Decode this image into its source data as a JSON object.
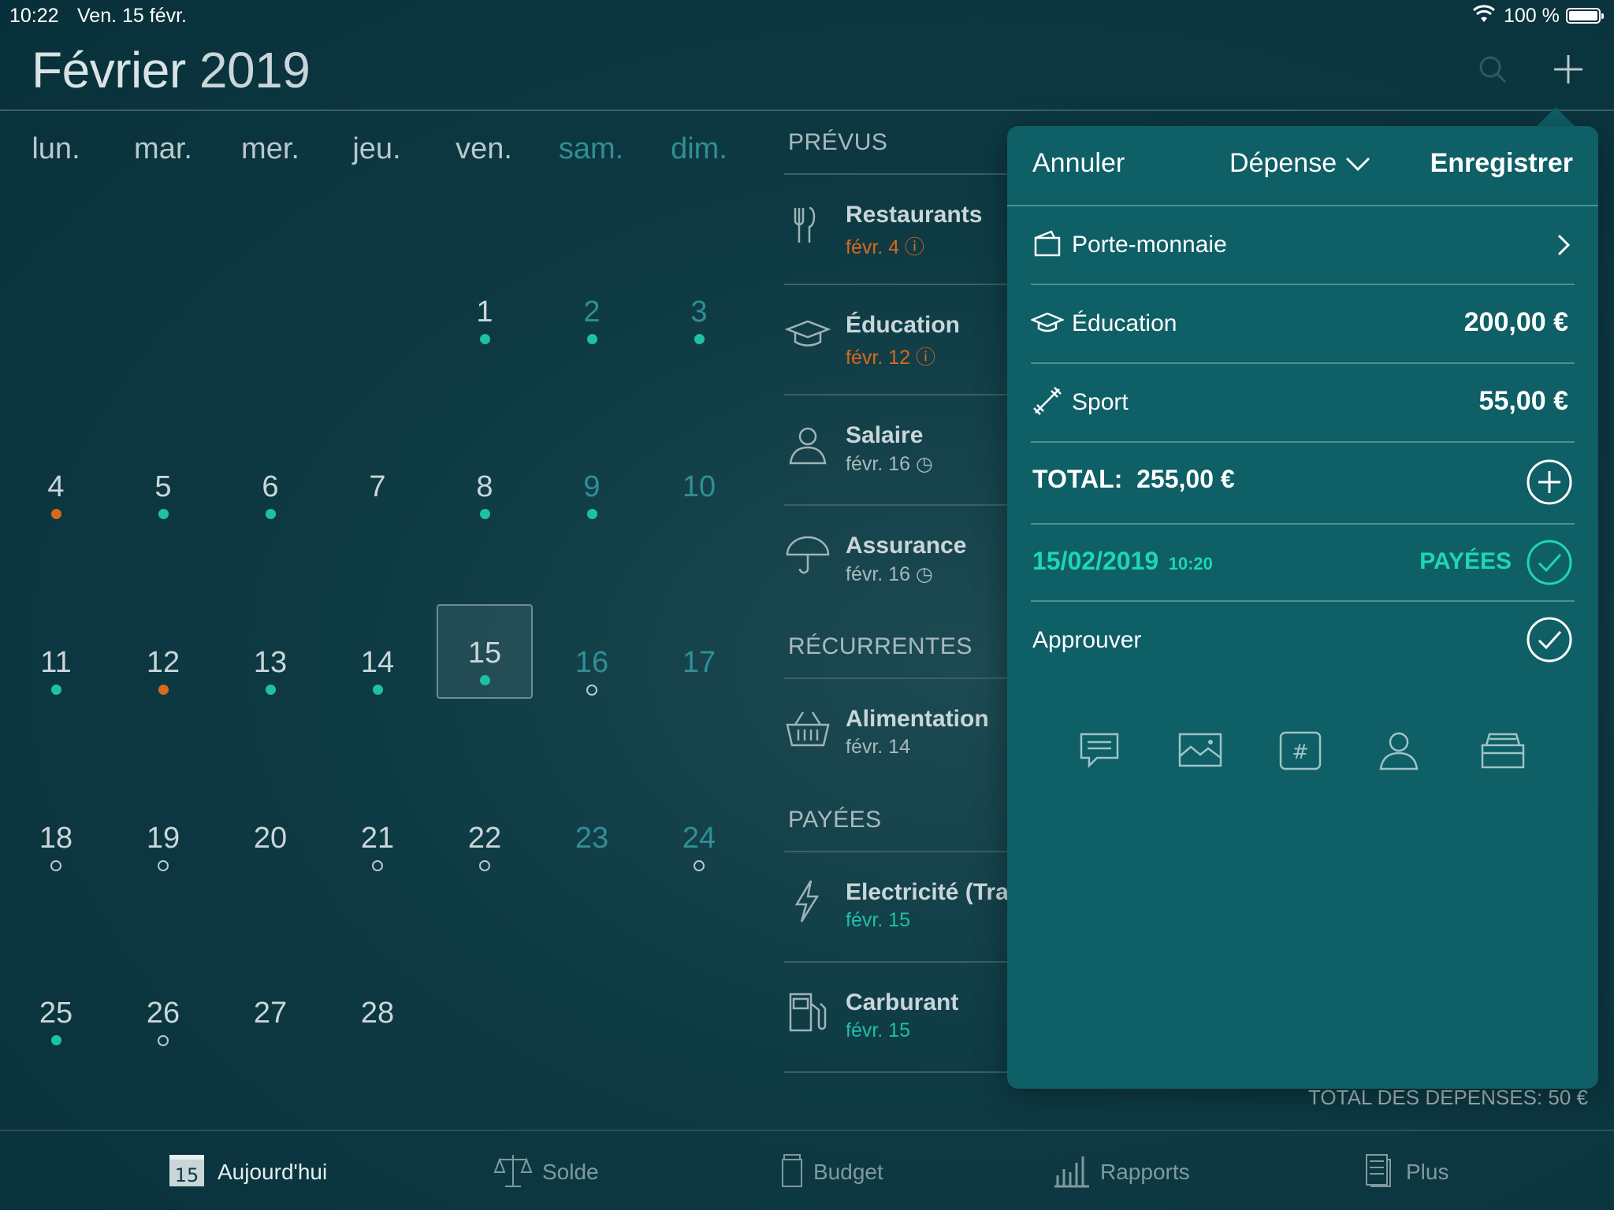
{
  "status_bar": {
    "time": "10:22",
    "date": "Ven. 15 févr.",
    "battery": "100 %"
  },
  "header": {
    "month": "Février",
    "year": "2019"
  },
  "weekdays": [
    "lun.",
    "mar.",
    "mer.",
    "jeu.",
    "ven.",
    "sam.",
    "dim."
  ],
  "calendar": {
    "days": [
      "1",
      "2",
      "3",
      "4",
      "5",
      "6",
      "7",
      "8",
      "9",
      "10",
      "11",
      "12",
      "13",
      "14",
      "15",
      "16",
      "17",
      "18",
      "19",
      "20",
      "21",
      "22",
      "23",
      "24",
      "25",
      "26",
      "27",
      "28"
    ],
    "today": "15"
  },
  "list": {
    "sections": {
      "planned": "PRÉVUS",
      "recurring": "RÉCURRENTES",
      "paid": "PAYÉES"
    },
    "planned": [
      {
        "name": "Restaurants",
        "date": "févr. 4"
      },
      {
        "name": "Éducation",
        "date": "févr. 12"
      },
      {
        "name": "Salaire",
        "date": "févr. 16"
      },
      {
        "name": "Assurance",
        "date": "févr. 16"
      }
    ],
    "recurring": [
      {
        "name": "Alimentation",
        "date": "févr. 14"
      }
    ],
    "paid": [
      {
        "name": "Electricité (Tra",
        "date": "févr. 15"
      },
      {
        "name": "Carburant",
        "date": "févr. 15"
      }
    ],
    "total_expenses": "TOTAL DES DÉPENSES: 50 €"
  },
  "popover": {
    "cancel": "Annuler",
    "type": "Dépense",
    "save": "Enregistrer",
    "account": "Porte-monnaie",
    "lines": [
      {
        "label": "Éducation",
        "amount": "200,00 €"
      },
      {
        "label": "Sport",
        "amount": "55,00 €"
      }
    ],
    "total_label": "TOTAL:",
    "total_value": "255,00 €",
    "date": "15/02/2019",
    "time": "10:20",
    "paid_label": "PAYÉES",
    "approve": "Approuver"
  },
  "tabs": [
    {
      "label": "Aujourd'hui",
      "badge": "15"
    },
    {
      "label": "Solde"
    },
    {
      "label": "Budget"
    },
    {
      "label": "Rapports"
    },
    {
      "label": "Plus"
    }
  ],
  "colors": {
    "accent": "#1dc1a8",
    "orange": "#d86a1a",
    "popover": "#0e5f66",
    "background": "#0e3a44"
  }
}
